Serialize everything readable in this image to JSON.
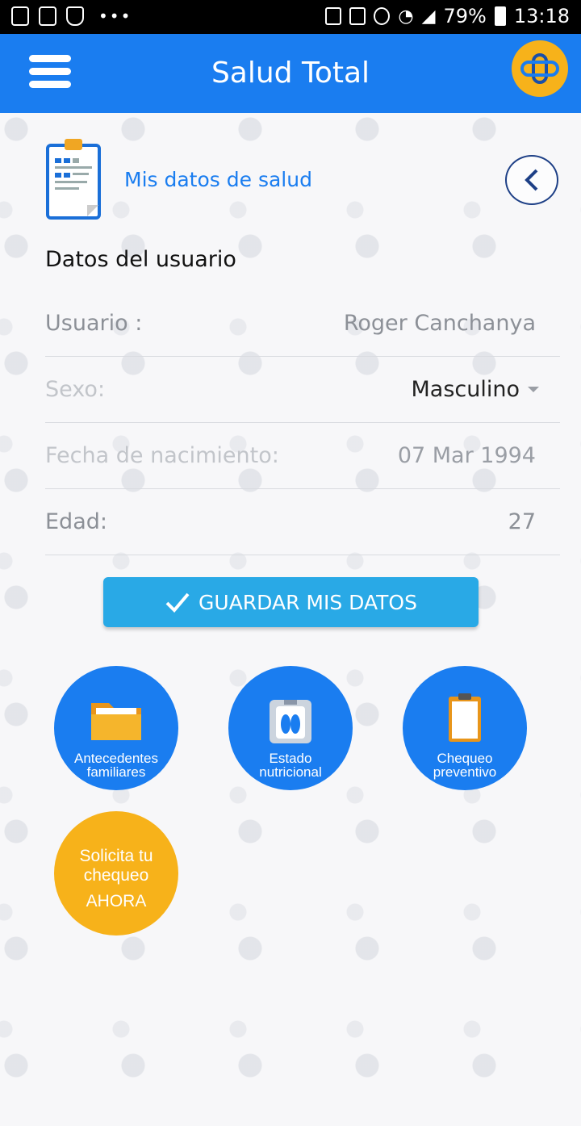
{
  "status_bar": {
    "battery": "79%",
    "time": "13:18",
    "dots": "•••"
  },
  "app_bar": {
    "title": "Salud Total"
  },
  "section": {
    "link_label": "Mis datos de salud"
  },
  "user_section": {
    "title": "Datos del usuario",
    "fields": {
      "usuario": {
        "label": "Usuario :",
        "value": "Roger Canchanya"
      },
      "sexo": {
        "label": "Sexo:",
        "value": "Masculino"
      },
      "fecha": {
        "label": "Fecha de nacimiento:",
        "value": "07 Mar 1994"
      },
      "edad": {
        "label": "Edad:",
        "value": "27"
      }
    }
  },
  "save_button": {
    "label": "GUARDAR MIS DATOS"
  },
  "actions": [
    {
      "line1": "Antecedentes",
      "line2": "familiares"
    },
    {
      "line1": "Estado",
      "line2": "nutricional"
    },
    {
      "line1": "Chequeo",
      "line2": "preventivo"
    }
  ],
  "cta": {
    "line1": "Solicita tu",
    "line2": "chequeo",
    "line3": "AHORA"
  },
  "colors": {
    "primary": "#1a7df0",
    "accent": "#f7b21a",
    "save": "#29a9e6",
    "back_border": "#1d3f86"
  }
}
